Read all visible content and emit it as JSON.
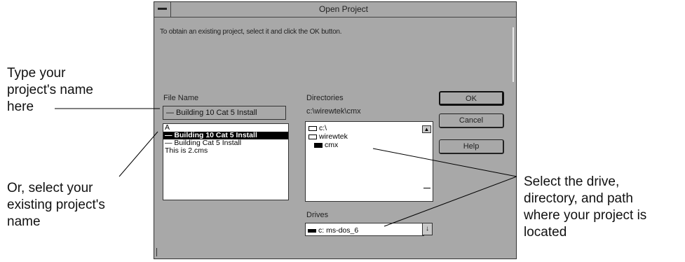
{
  "dialog": {
    "title": "Open Project",
    "instruction": "To obtain an existing project, select it and click the OK button.",
    "file_name_label": "File Name",
    "file_name_value": "— Building 10 Cat 5 Install",
    "file_list": [
      "A",
      "— Building 10 Cat 5 Install",
      "— Building Cat 5 Install",
      "This is 2.cms"
    ],
    "directories_label": "Directories",
    "current_path": "c:\\wirewtek\\cmx",
    "directory_tree": [
      "c:\\",
      "wirewtek",
      "cmx"
    ],
    "drives_label": "Drives",
    "drive_value": "c: ms-dos_6",
    "buttons": {
      "ok": "OK",
      "cancel": "Cancel",
      "help": "Help"
    }
  },
  "callouts": {
    "type_name": [
      "Type your",
      "project's name",
      "here"
    ],
    "select_existing": [
      "Or, select your",
      "existing project's",
      "name"
    ],
    "select_drive": [
      "Select the drive,",
      "directory, and path",
      "where your project is",
      "located"
    ]
  }
}
